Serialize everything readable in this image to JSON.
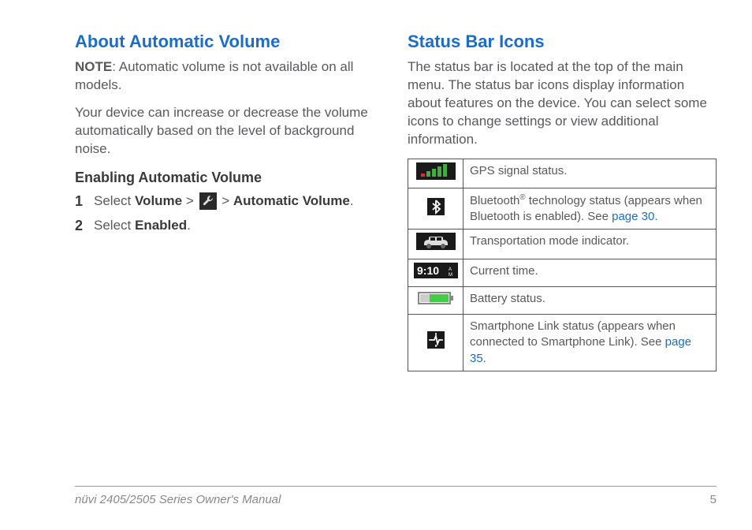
{
  "left": {
    "heading": "About Automatic Volume",
    "note_label": "NOTE",
    "note_text": ": Automatic volume is not available on all models.",
    "para1": "Your device can increase or decrease the volume automatically based on the level of background noise.",
    "subheading": "Enabling Automatic Volume",
    "step1_prefix": "Select ",
    "step1_volume": "Volume",
    "step1_sep1": " > ",
    "step1_sep2": " > ",
    "step1_auto": "Automatic Volume",
    "step1_suffix": ".",
    "step2_prefix": "Select ",
    "step2_enabled": "Enabled",
    "step2_suffix": "."
  },
  "right": {
    "heading": "Status Bar Icons",
    "para1": "The status bar is located at the top of the main menu. The status bar icons display information about features on the device. You can select some icons to change settings or view additional information.",
    "rows": {
      "r1": "GPS signal status.",
      "r2a": "Bluetooth",
      "r2b": " technology status (appears when Bluetooth is enabled). See ",
      "r2link": "page 30.",
      "r3": "Transportation mode indicator.",
      "r4": "Current time.",
      "r5": "Battery status.",
      "r6a": "Smartphone Link status (appears when connected to Smartphone Link). See ",
      "r6link": "page 35."
    }
  },
  "footer": {
    "manual": "nüvi 2405/2505 Series Owner's Manual",
    "page": "5"
  }
}
